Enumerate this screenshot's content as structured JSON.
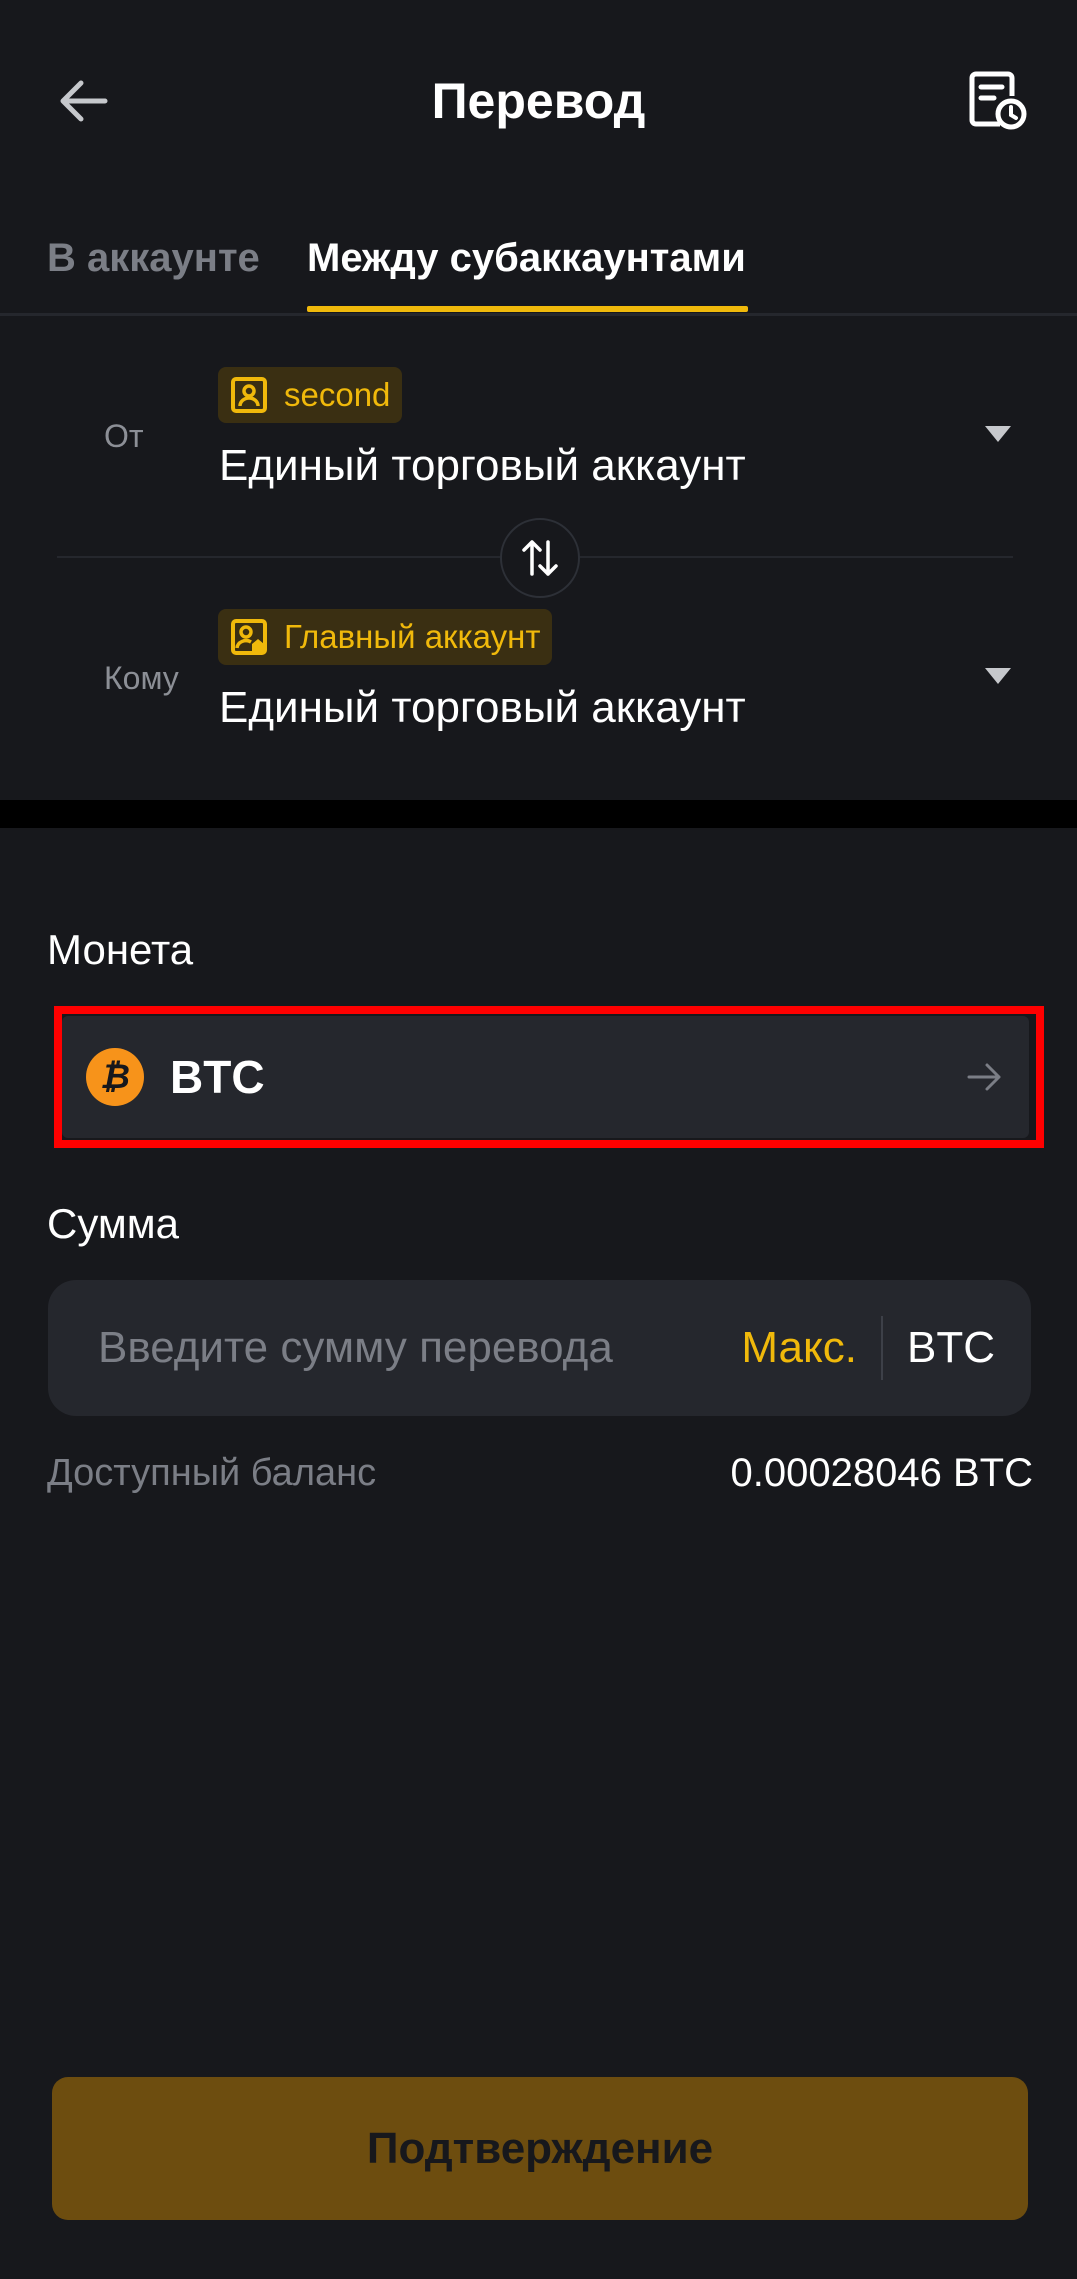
{
  "header": {
    "title": "Перевод"
  },
  "tabs": [
    {
      "label": "В аккаунте",
      "active": false
    },
    {
      "label": "Между субаккаунтами",
      "active": true
    }
  ],
  "transfer": {
    "from": {
      "label": "От",
      "tag": "second",
      "account": "Единый торговый аккаунт"
    },
    "to": {
      "label": "Кому",
      "tag": "Главный аккаунт",
      "account": "Единый торговый аккаунт"
    }
  },
  "coin": {
    "label": "Монета",
    "selected": "BTC",
    "icon_glyph": "₿"
  },
  "amount": {
    "label": "Сумма",
    "placeholder": "Введите сумму перевода",
    "value": "",
    "max_label": "Макс.",
    "unit": "BTC"
  },
  "balance": {
    "label": "Доступный баланс",
    "value": "0.00028046 BTC"
  },
  "confirm_label": "Подтверждение",
  "colors": {
    "accent": "#f0b90b",
    "background": "#17181c",
    "field": "#25272d",
    "highlight": "#ff0000"
  }
}
